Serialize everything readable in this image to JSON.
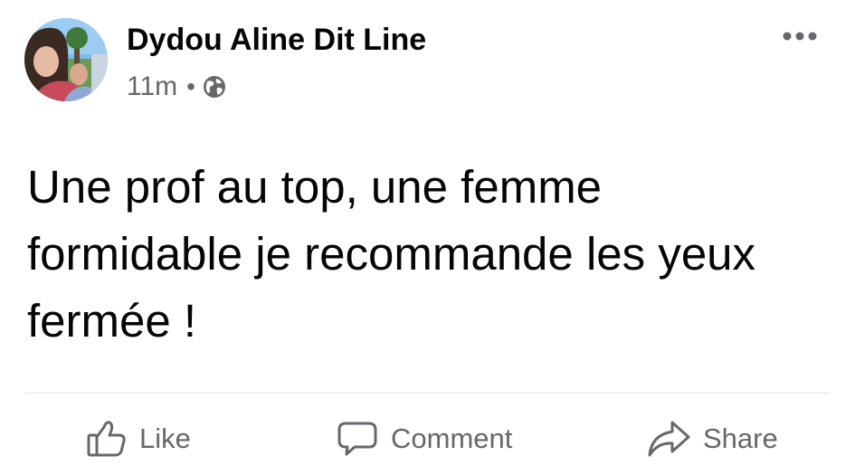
{
  "post": {
    "author": "Dydou Aline Dit Line",
    "time": "11m",
    "separator": "•",
    "privacy_icon": "globe-icon",
    "more_icon": "more-options-icon",
    "text": "Une prof au top, une femme formidable je recommande les yeux fermée !"
  },
  "actions": {
    "like_label": "Like",
    "comment_label": "Comment",
    "share_label": "Share"
  },
  "colors": {
    "text_primary": "#050505",
    "text_secondary": "#65676b",
    "divider": "#dadde1"
  }
}
